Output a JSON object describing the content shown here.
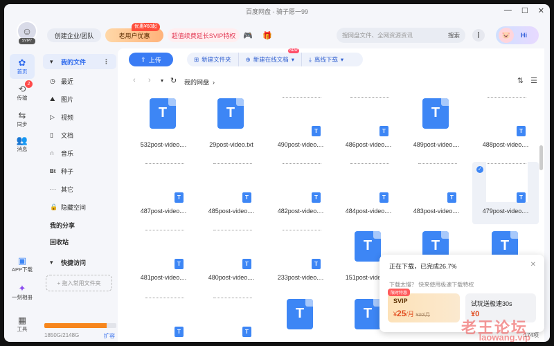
{
  "window": {
    "title": "百度网盘 - 骑子愿一99"
  },
  "header": {
    "avatar_badge": "SVIP7",
    "enterprise_label": "创建企业/团队",
    "newuser_label": "老用户优惠",
    "newuser_tag": "优惠¥60起",
    "svip_label": "超值续费延长SVIP特权",
    "search_placeholder": "搜网盘文件、全网资源资讯",
    "search_button": "搜索",
    "hi_label": "Hi"
  },
  "leftnav": [
    {
      "label": "首页",
      "icon": "home-icon",
      "active": true
    },
    {
      "label": "传输",
      "icon": "transfer-icon",
      "badge": "2"
    },
    {
      "label": "同步",
      "icon": "sync-icon"
    },
    {
      "label": "消息",
      "icon": "message-icon"
    },
    {
      "label": "APP下载",
      "icon": "app-icon"
    },
    {
      "label": "一刻相册",
      "icon": "album-icon"
    },
    {
      "label": "工具",
      "icon": "tools-icon"
    }
  ],
  "sidebar": {
    "my_files": "我的文件",
    "items": [
      {
        "label": "最近",
        "icon": "clock-icon"
      },
      {
        "label": "图片",
        "icon": "image-icon"
      },
      {
        "label": "视频",
        "icon": "video-icon"
      },
      {
        "label": "文档",
        "icon": "document-icon"
      },
      {
        "label": "音乐",
        "icon": "music-icon"
      },
      {
        "label": "种子",
        "icon": "bt-icon"
      },
      {
        "label": "其它",
        "icon": "other-icon"
      },
      {
        "label": "隐藏空间",
        "icon": "lock-icon"
      }
    ],
    "my_share": "我的分享",
    "recycle": "回收站",
    "quick_access": "快捷访问",
    "drop_hint": "+ 拖入常用文件夹",
    "storage_text": "1850G/2148G",
    "storage_fraction": 0.861,
    "expand_label": "扩容"
  },
  "toolbar": {
    "upload": "上传",
    "new_folder": "新建文件夹",
    "new_doc": "新建在线文档",
    "new_tag": "NEW",
    "offline": "离线下载"
  },
  "path": {
    "breadcrumb": "我的网盘"
  },
  "files": [
    {
      "name": "532post-video....",
      "kind": "big"
    },
    {
      "name": "29post-video.txt",
      "kind": "big"
    },
    {
      "name": "490post-video....",
      "kind": "thumb"
    },
    {
      "name": "486post-video....",
      "kind": "thumb"
    },
    {
      "name": "489post-video....",
      "kind": "big"
    },
    {
      "name": "488post-video....",
      "kind": "thumb"
    },
    {
      "name": "487post-video....",
      "kind": "thumb"
    },
    {
      "name": "485post-video....",
      "kind": "thumb"
    },
    {
      "name": "482post-video....",
      "kind": "thumb"
    },
    {
      "name": "484post-video....",
      "kind": "thumb"
    },
    {
      "name": "483post-video....",
      "kind": "thumb"
    },
    {
      "name": "479post-video....",
      "kind": "thumb",
      "selected": true
    },
    {
      "name": "481post-video....",
      "kind": "thumb"
    },
    {
      "name": "480post-video....",
      "kind": "thumb"
    },
    {
      "name": "233post-video....",
      "kind": "thumb"
    },
    {
      "name": "151post-video....",
      "kind": "big"
    },
    {
      "name": "",
      "kind": "big"
    },
    {
      "name": "",
      "kind": "big"
    },
    {
      "name": "",
      "kind": "thumb"
    },
    {
      "name": "",
      "kind": "thumb"
    },
    {
      "name": "",
      "kind": "big"
    },
    {
      "name": "",
      "kind": "big"
    }
  ],
  "footer": {
    "count": "174项"
  },
  "popup": {
    "title": "正在下载，已完成26.7%",
    "subtitle": "下载太慢？ 快来使用极速下载特权",
    "svip_tag": "限时特惠",
    "svip_label": "SVIP",
    "svip_price": "25",
    "svip_unit": "/月",
    "svip_old": "¥30/月",
    "trial_label": "试玩送极速30s",
    "trial_price": "¥0"
  },
  "watermark": {
    "text": "老王论坛",
    "sub": "laowang.vip"
  }
}
